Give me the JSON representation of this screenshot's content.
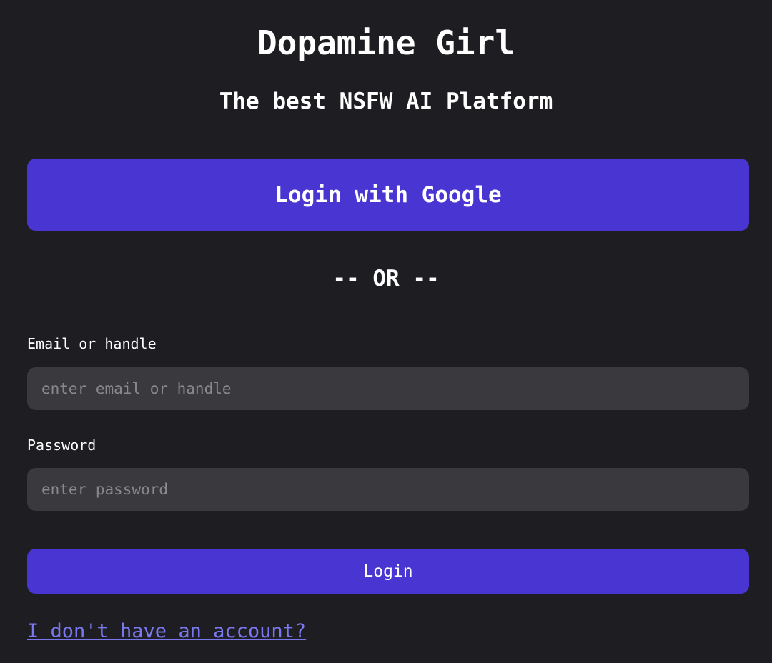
{
  "header": {
    "title": "Dopamine Girl",
    "subtitle": "The best NSFW AI Platform"
  },
  "auth": {
    "google_button_label": "Login with Google",
    "divider_text": "-- OR --",
    "email": {
      "label": "Email or handle",
      "placeholder": "enter email or handle",
      "value": ""
    },
    "password": {
      "label": "Password",
      "placeholder": "enter password",
      "value": ""
    },
    "login_button_label": "Login",
    "signup_link_text": "I don't have an account?"
  },
  "colors": {
    "background": "#1e1e22",
    "accent": "#4935d2",
    "input_background": "#3a3a3e",
    "link": "#7a78f0"
  }
}
